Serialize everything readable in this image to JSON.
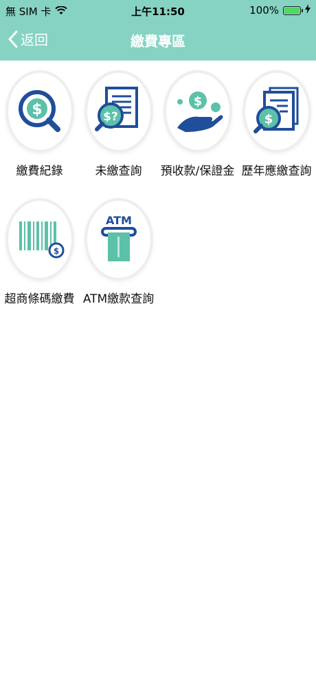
{
  "status_bar": {
    "carrier": "無 SIM 卡",
    "time": "上午11:50",
    "battery": "100%"
  },
  "nav": {
    "back_label": "返回",
    "title": "繳費專區"
  },
  "tiles": [
    {
      "label": "繳費紀錄",
      "icon": "dollar-magnifier-icon"
    },
    {
      "label": "未繳查詢",
      "icon": "unpaid-bill-search-icon"
    },
    {
      "label": "預收款/保證金",
      "icon": "hand-coins-icon"
    },
    {
      "label": "歷年應繳查詢",
      "icon": "bill-history-search-icon"
    },
    {
      "label": "超商條碼繳費",
      "icon": "barcode-icon"
    },
    {
      "label": "ATM繳款查詢",
      "icon": "atm-icon"
    }
  ],
  "colors": {
    "header": "#86d3c3",
    "icon_blue": "#1f4e9a",
    "icon_teal": "#5cc1a9"
  }
}
